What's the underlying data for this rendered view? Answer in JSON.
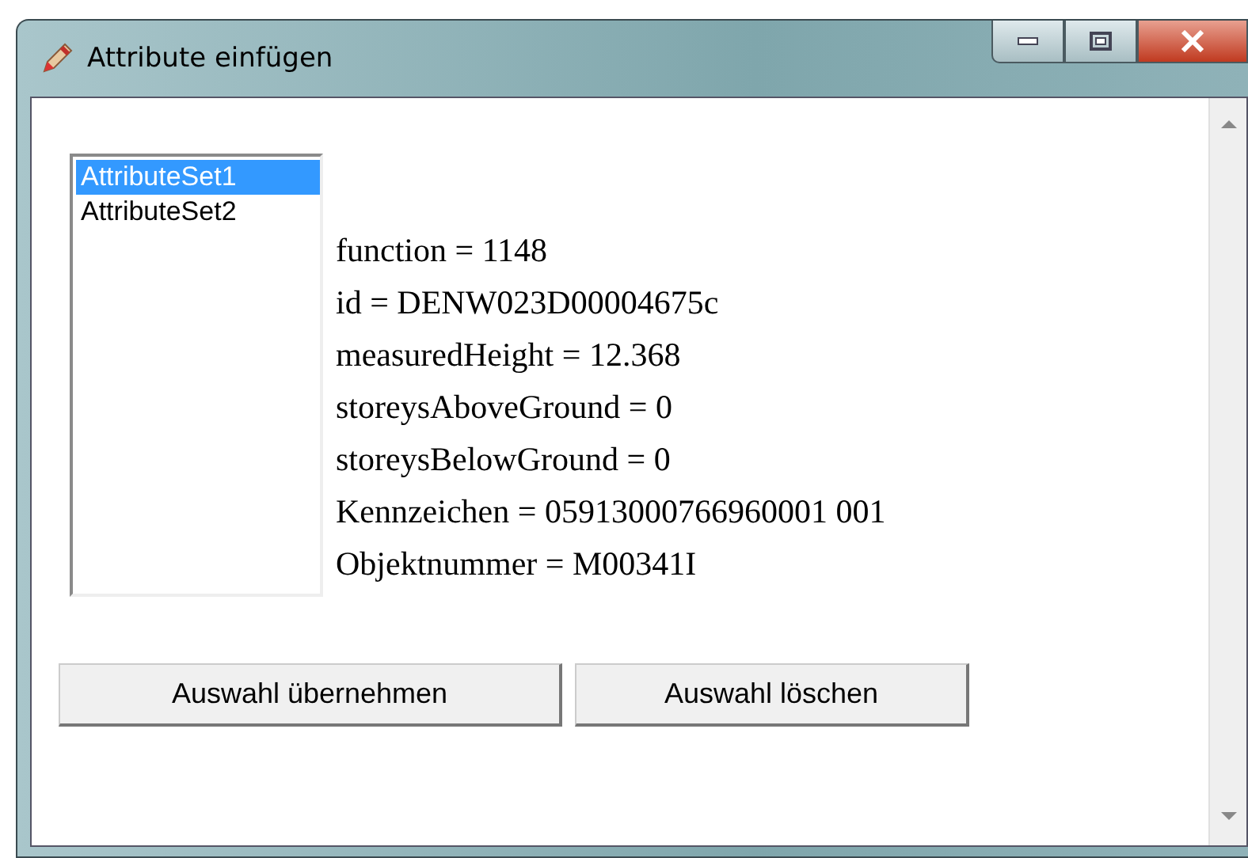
{
  "window": {
    "title": "Attribute einfügen"
  },
  "list": [
    {
      "label": "AttributeSet1",
      "selected": true
    },
    {
      "label": "AttributeSet2",
      "selected": false
    }
  ],
  "attributes": [
    "function = 1148",
    "id = DENW023D00004675c",
    "measuredHeight = 12.368",
    "storeysAboveGround = 0",
    "storeysBelowGround = 0",
    "Kennzeichen = 05913000766960001 001",
    "Objektnummer = M00341I"
  ],
  "buttons": [
    "Auswahl übernehmen",
    "Auswahl löschen"
  ]
}
